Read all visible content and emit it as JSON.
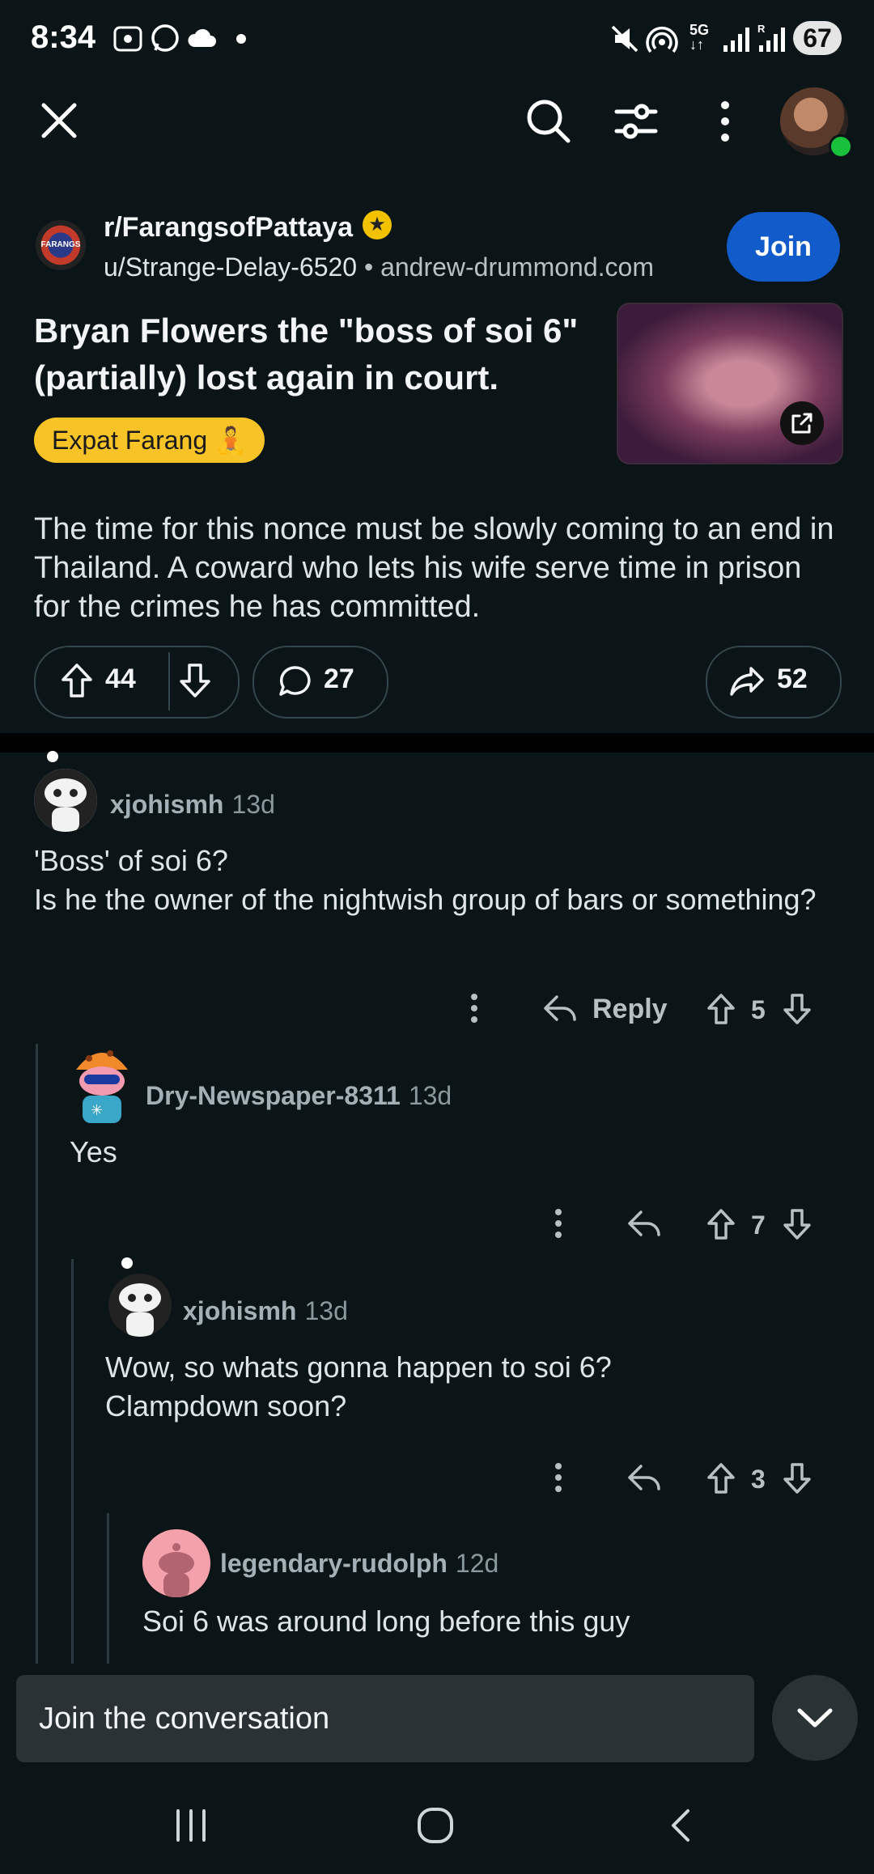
{
  "status_bar": {
    "time": "8:34",
    "battery": "67"
  },
  "post": {
    "subreddit": "r/FarangsofPattaya",
    "sub_icon_text": "FARANGS PATTAYA",
    "author": "u/Strange-Delay-6520",
    "separator": "•",
    "domain": "andrew-drummond.com",
    "join_label": "Join",
    "title": "Bryan Flowers the \"boss of soi 6\" (partially) lost again in court.",
    "flair": "Expat Farang 🧘",
    "body": "The time for this nonce must be slowly coming to an end in Thailand. A coward who lets his wife serve time in prison for the crimes he has committed.",
    "upvotes": "44",
    "comments": "27",
    "shares": "52"
  },
  "comments": [
    {
      "author": "xjohismh",
      "time": "13d",
      "text_lines": [
        "'Boss' of soi 6?",
        "Is he the owner of the nightwish group of bars or something?"
      ],
      "reply_label": "Reply",
      "votes": "5"
    },
    {
      "author": "Dry-Newspaper-8311",
      "time": "13d",
      "text_lines": [
        "Yes"
      ],
      "votes": "7"
    },
    {
      "author": "xjohismh",
      "time": "13d",
      "text_lines": [
        "Wow, so whats gonna happen to soi 6?",
        "Clampdown soon?"
      ],
      "votes": "3"
    },
    {
      "author": "legendary-rudolph",
      "time": "12d",
      "text_lines": [
        "Soi 6 was around long before this guy"
      ]
    }
  ],
  "composer": {
    "placeholder": "Join the conversation"
  },
  "colors": {
    "background": "#0b1416",
    "join_button": "#115bca",
    "flair": "#f7c326",
    "online": "#18c03b"
  }
}
